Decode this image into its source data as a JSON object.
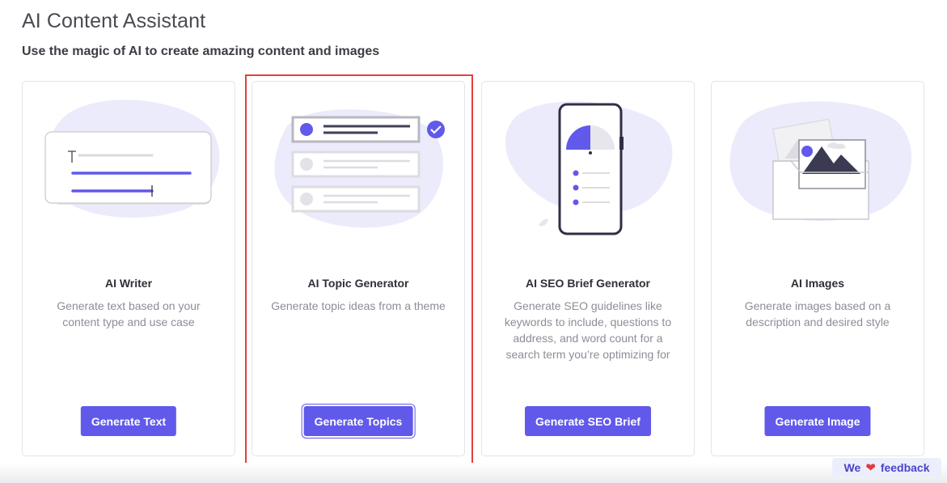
{
  "page": {
    "title": "AI Content Assistant",
    "subtitle": "Use the magic of AI to create amazing content and images"
  },
  "cards": [
    {
      "title": "AI Writer",
      "description": "Generate text based on your content type and use case",
      "button_label": "Generate Text"
    },
    {
      "title": "AI Topic Generator",
      "description": "Generate topic ideas from a theme",
      "button_label": "Generate Topics"
    },
    {
      "title": "AI SEO Brief Generator",
      "description": "Generate SEO guidelines like keywords to include, questions to address, and word count for a search term you’re optimizing for",
      "button_label": "Generate SEO Brief"
    },
    {
      "title": "AI Images",
      "description": "Generate images based on a description and desired style",
      "button_label": "Generate Image"
    }
  ],
  "feedback": {
    "before": "We",
    "icon": "heart-icon",
    "after": "feedback"
  },
  "colors": {
    "accent": "#6159ea",
    "blob": "#ebebfb",
    "highlight": "#e53f3f"
  }
}
